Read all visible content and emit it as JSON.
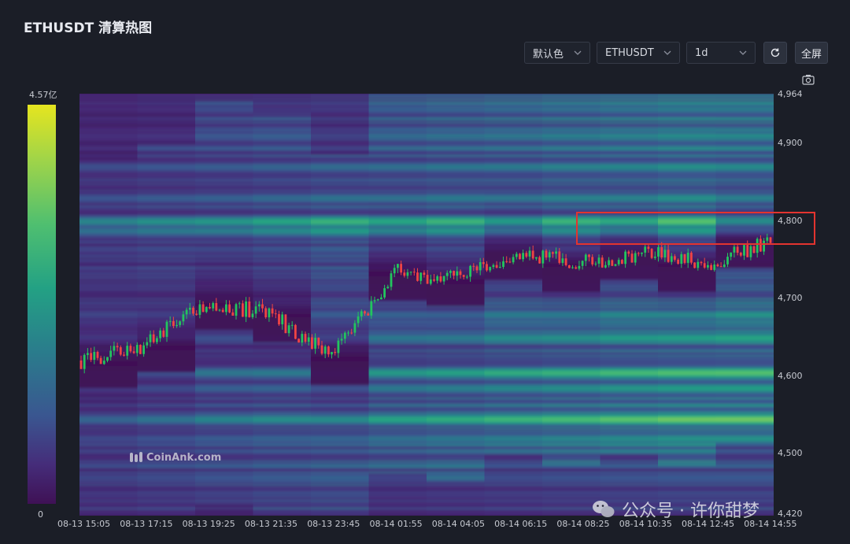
{
  "page": {
    "title": "ETHUSDT 清算热图"
  },
  "controls": {
    "color_select": "默认色",
    "symbol_select": "ETHUSDT",
    "interval_select": "1d",
    "fullscreen_label": "全屏"
  },
  "colors": {
    "background": "#1b1e27",
    "heatmap_low": "#3f1155",
    "heatmap_mid": "#23a184",
    "heatmap_high": "#e6e51f",
    "candle_up": "#22c55e",
    "candle_down": "#ef4444",
    "highlight_box": "#e3342f"
  },
  "icons": [
    "chevron-down-icon",
    "refresh-icon",
    "camera-icon",
    "coinank-logo-icon",
    "wechat-icon"
  ],
  "chart_data": {
    "type": "heatmap",
    "title": "ETHUSDT 清算热图",
    "color_scale": {
      "max_label": "4.57亿",
      "min_label": "0"
    },
    "y_ticks": [
      "4,964",
      "4,900",
      "4,800",
      "4,700",
      "4,600",
      "4,500",
      "4,420"
    ],
    "ylim": [
      4420,
      4964
    ],
    "x_ticks": [
      "08-13 15:05",
      "08-13 17:15",
      "08-13 19:25",
      "08-13 21:35",
      "08-13 23:45",
      "08-14 01:55",
      "08-14 04:05",
      "08-14 06:15",
      "08-14 08:25",
      "08-14 10:35",
      "08-14 12:45",
      "08-14 14:55"
    ],
    "price_series": [
      {
        "t": "08-13 15:05",
        "close": 4620
      },
      {
        "t": "08-13 17:15",
        "close": 4640
      },
      {
        "t": "08-13 19:25",
        "close": 4695
      },
      {
        "t": "08-13 21:35",
        "close": 4680
      },
      {
        "t": "08-13 23:45",
        "close": 4625
      },
      {
        "t": "08-14 01:55",
        "close": 4735
      },
      {
        "t": "08-14 04:05",
        "close": 4725
      },
      {
        "t": "08-14 06:15",
        "close": 4760
      },
      {
        "t": "08-14 08:25",
        "close": 4745
      },
      {
        "t": "08-14 10:35",
        "close": 4760
      },
      {
        "t": "08-14 12:45",
        "close": 4745
      },
      {
        "t": "08-14 14:55",
        "close": 4775
      }
    ],
    "liquidation_bands": [
      {
        "price": 4800,
        "intensity": 0.98
      },
      {
        "price": 4788,
        "intensity": 0.8
      },
      {
        "price": 4830,
        "intensity": 0.55
      },
      {
        "price": 4870,
        "intensity": 0.5
      },
      {
        "price": 4910,
        "intensity": 0.45
      },
      {
        "price": 4945,
        "intensity": 0.4
      },
      {
        "price": 4680,
        "intensity": 0.55
      },
      {
        "price": 4650,
        "intensity": 0.6
      },
      {
        "price": 4605,
        "intensity": 0.75
      },
      {
        "price": 4585,
        "intensity": 0.55
      },
      {
        "price": 4545,
        "intensity": 0.8
      },
      {
        "price": 4520,
        "intensity": 0.5
      },
      {
        "price": 4470,
        "intensity": 0.45
      }
    ],
    "highlight": {
      "price_from": 4783,
      "price_to": 4823
    }
  },
  "branding": {
    "logo_text": "CoinAnk.com",
    "watermark": "公众号 · 许你甜梦"
  }
}
